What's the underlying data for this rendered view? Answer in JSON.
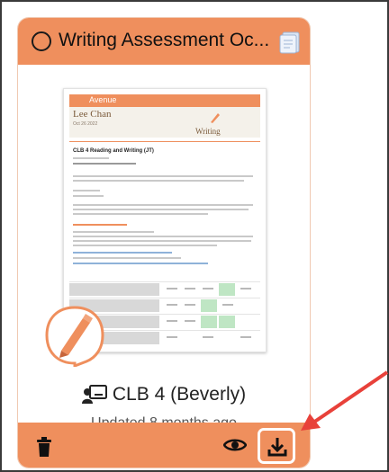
{
  "card": {
    "title": "Writing Assessment Oc...",
    "class_name": "CLB 4 (Beverly)",
    "updated": "Updated 8 months ago"
  },
  "document": {
    "brand": "Avenue",
    "student": "Lee Chan",
    "date": "Oct 26 2022",
    "subject": "Writing",
    "heading": "CLB 4 Reading and Writing (JT)"
  },
  "icons": {
    "status": "empty-circle-icon",
    "badge": "document-stack-icon",
    "class": "classroom-icon",
    "delete": "trash-icon",
    "view": "eye-icon",
    "download": "download-icon"
  },
  "colors": {
    "accent": "#ef8f5d",
    "annotation_arrow": "#e8413a"
  }
}
